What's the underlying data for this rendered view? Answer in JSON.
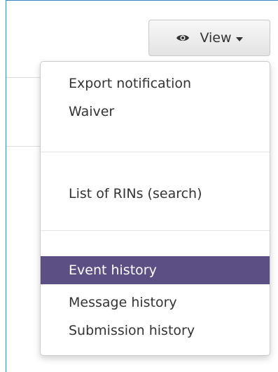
{
  "view_button": {
    "label": "View",
    "icon": "eye-icon",
    "caret": "caret-down-icon"
  },
  "menu": {
    "items": [
      {
        "label": "Export notification",
        "active": false
      },
      {
        "label": "Waiver",
        "active": false
      },
      {
        "label": "List of RINs (search)",
        "active": false
      },
      {
        "label": "Event history",
        "active": true
      },
      {
        "label": "Message history",
        "active": false
      },
      {
        "label": "Submission history",
        "active": false
      }
    ],
    "active_color": "#5b4f84"
  },
  "colors": {
    "panel_border": "#3b86c4",
    "text": "#333333"
  }
}
